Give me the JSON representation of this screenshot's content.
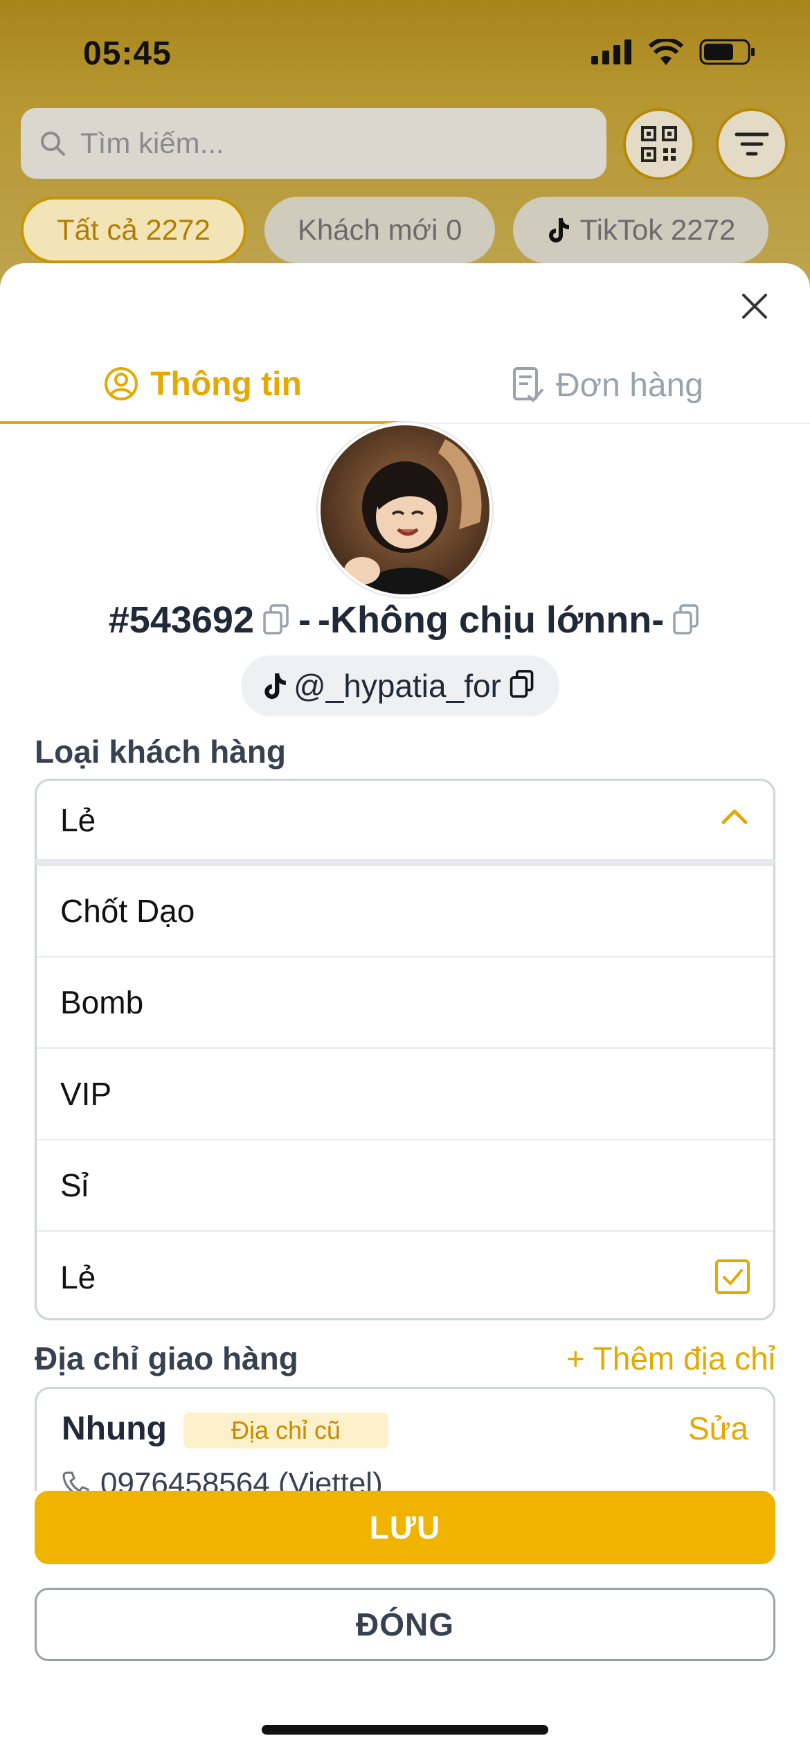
{
  "status": {
    "time": "05:45"
  },
  "header": {
    "search_placeholder": "Tìm kiếm...",
    "chips": [
      {
        "label": "Tất cả 2272"
      },
      {
        "label": "Khách mới 0"
      },
      {
        "label": "TikTok 2272"
      }
    ]
  },
  "tabs": [
    {
      "label": "Thông tin"
    },
    {
      "label": "Đơn hàng"
    }
  ],
  "profile": {
    "id": "#543692",
    "separator": "-",
    "name": "-Không chịu lớnnn-",
    "tiktok_handle": "@_hypatia_for"
  },
  "customer_type": {
    "label": "Loại khách hàng",
    "selected": "Lẻ",
    "options": [
      {
        "label": "Chốt Dạo"
      },
      {
        "label": "Bomb"
      },
      {
        "label": "VIP"
      },
      {
        "label": "Sỉ"
      },
      {
        "label": "Lẻ"
      }
    ]
  },
  "address": {
    "label": "Địa chỉ giao hàng",
    "add_label": "+ Thêm địa chỉ",
    "name": "Nhung",
    "badge": "Địa chỉ cũ",
    "edit_label": "Sửa",
    "phone": "0976458564 (Viettel)"
  },
  "actions": {
    "save": "LƯU",
    "close": "ĐÓNG"
  },
  "colors": {
    "accent": "#e6a900",
    "primary_button": "#f0b400"
  }
}
